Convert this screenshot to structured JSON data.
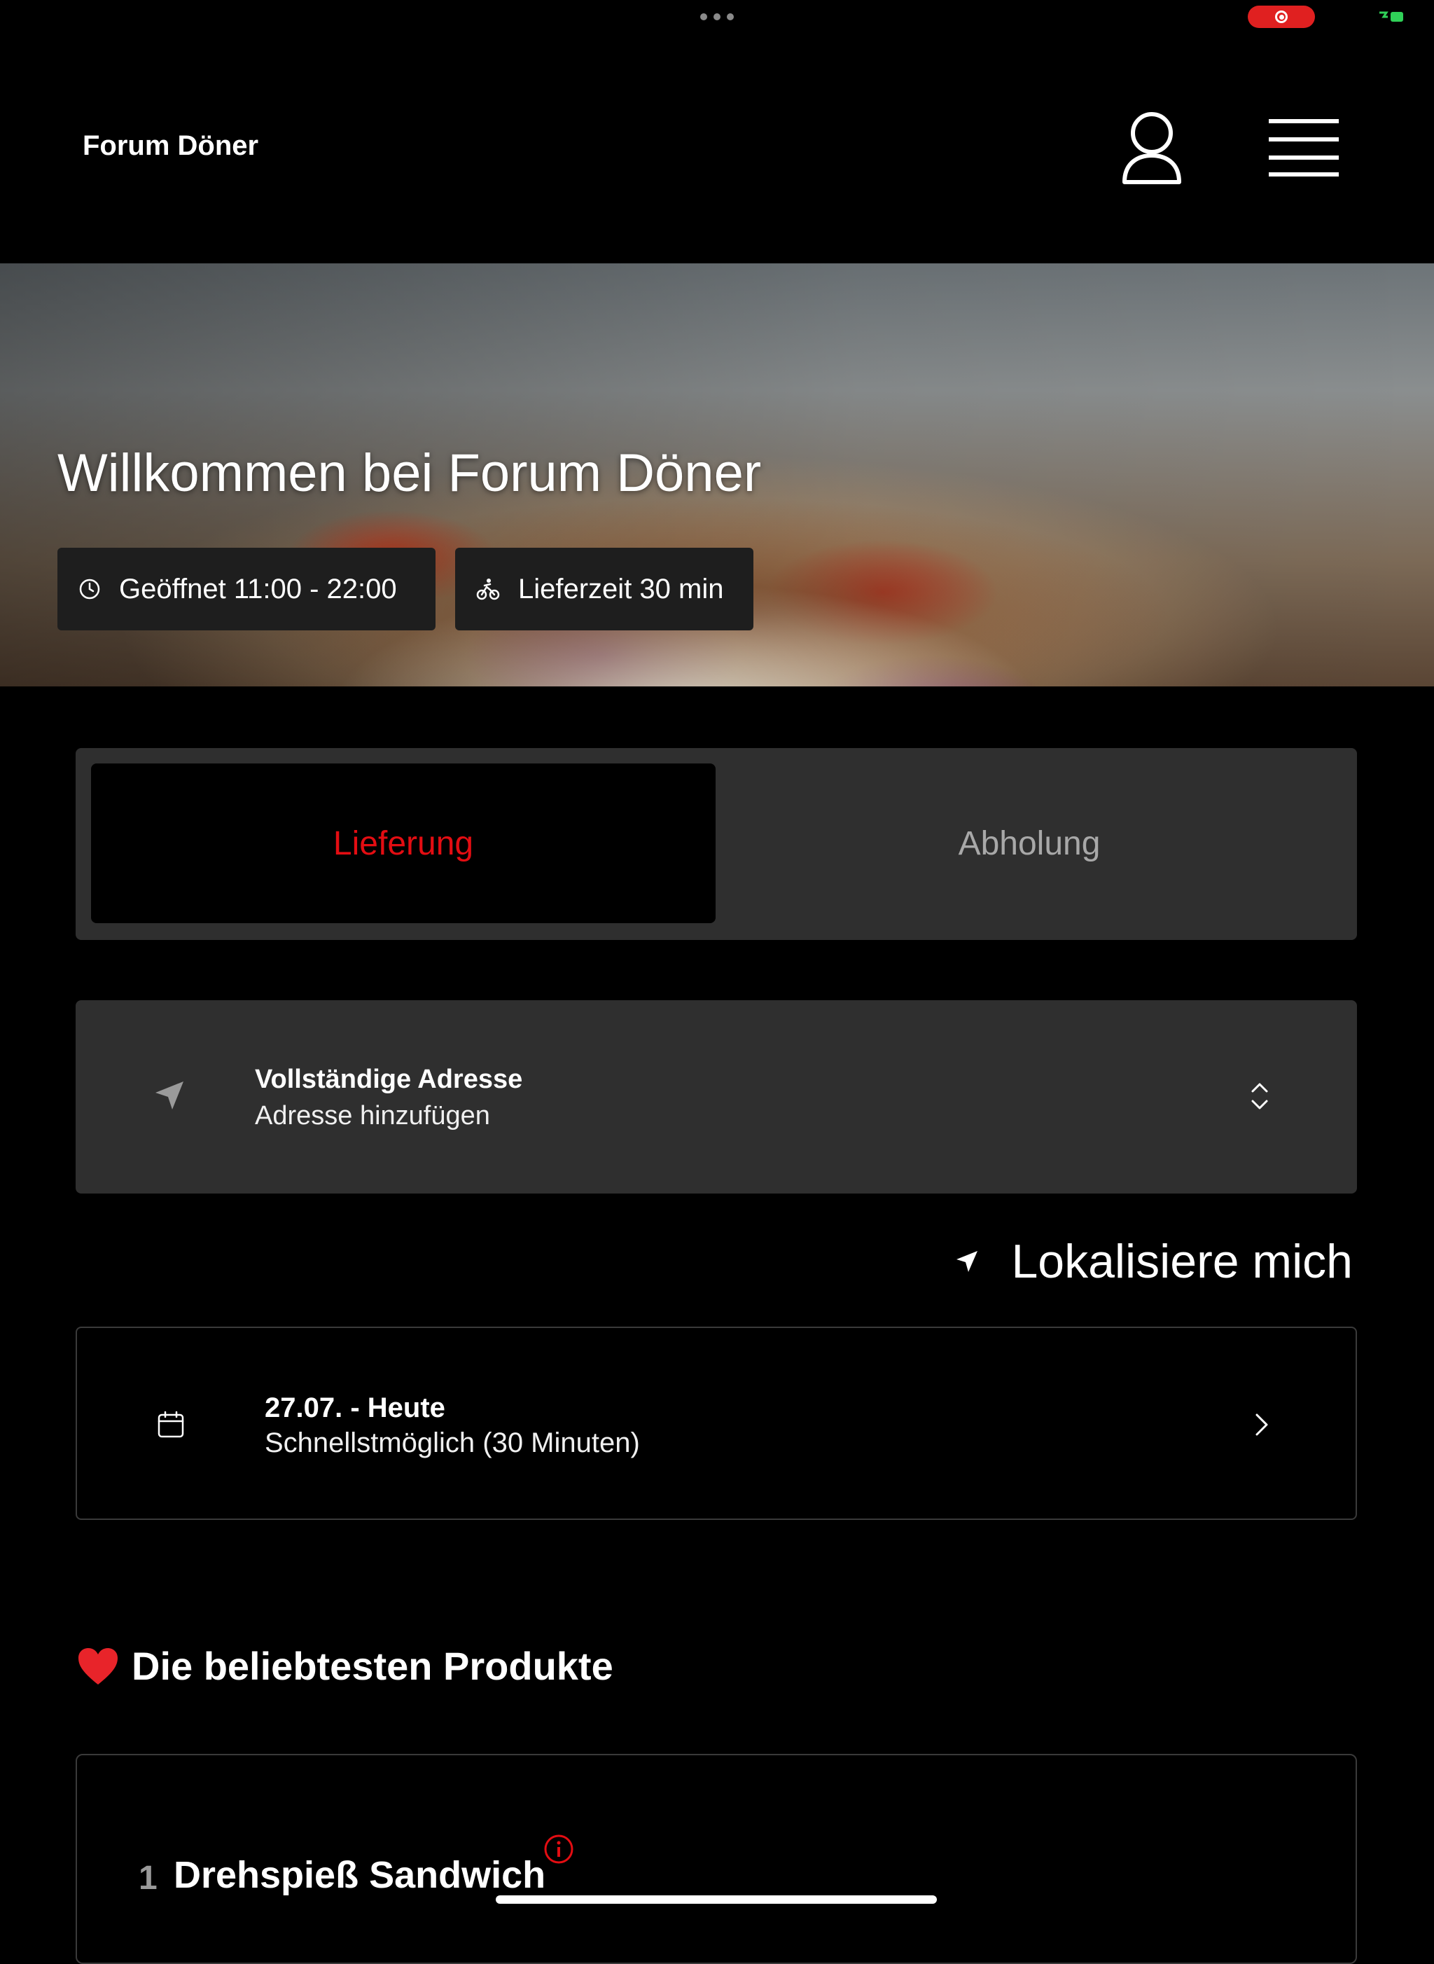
{
  "header": {
    "brand": "Forum Döner"
  },
  "hero": {
    "title": "Willkommen bei Forum Döner",
    "opening_hours": "Geöffnet 11:00 - 22:00",
    "delivery_time": "Lieferzeit 30 min"
  },
  "order_mode": {
    "delivery_label": "Lieferung",
    "pickup_label": "Abholung",
    "selected": "Lieferung",
    "accent_color": "#e30d12"
  },
  "address": {
    "title": "Vollständige Adresse",
    "value": "Adresse hinzufügen"
  },
  "locate_label": "Lokalisiere mich",
  "schedule": {
    "date": "27.07. - Heute",
    "time": "Schnellstmöglich (30 Minuten)"
  },
  "popular": {
    "heading": "Die beliebtesten Produkte",
    "heading_icon": "heart-icon",
    "products": [
      {
        "number": "1",
        "name": "Drehspieß Sandwich"
      }
    ]
  }
}
